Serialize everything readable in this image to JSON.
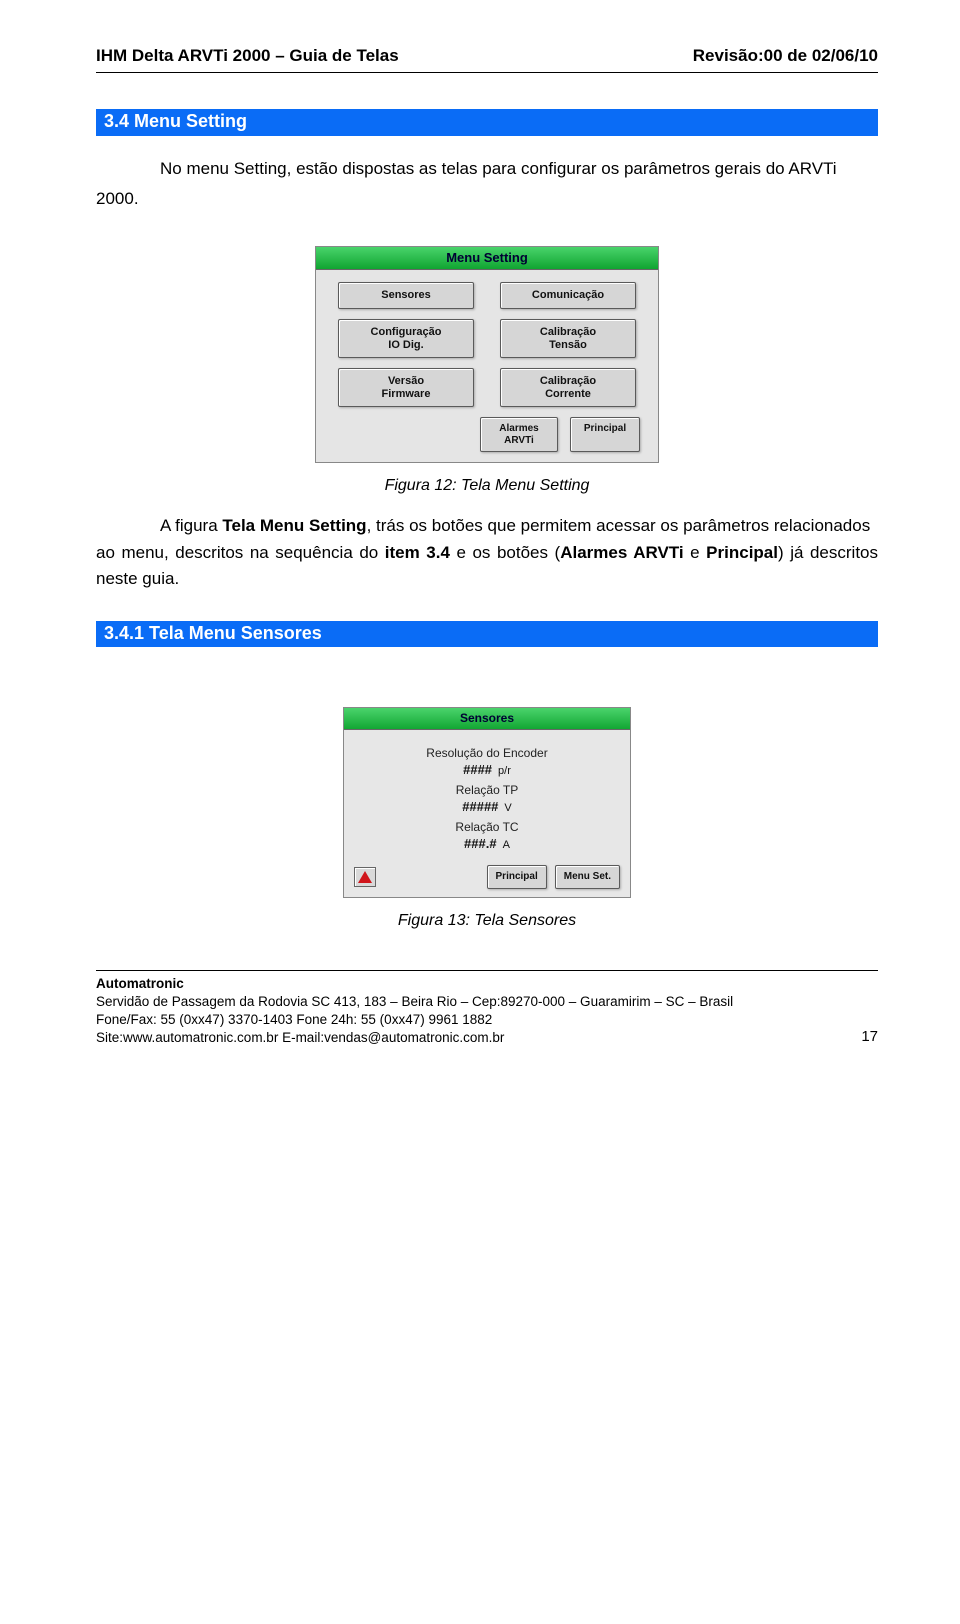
{
  "header": {
    "left": "IHM Delta ARVTi 2000 – Guia de Telas",
    "right": "Revisão:00 de 02/06/10"
  },
  "section1": {
    "title": "3.4  Menu Setting",
    "intro_right": "No menu Setting, estão dispostas as telas para configurar os parâmetros gerais do ARVTi",
    "intro_left": "2000."
  },
  "fig12": {
    "caption": "Figura 12: Tela Menu Setting",
    "hmi_title": "Menu Setting",
    "buttons": {
      "sensores": "Sensores",
      "comunicacao": "Comunicação",
      "config_io": "Configuração\nIO Dig.",
      "calib_tensao": "Calibração\nTensão",
      "versao_fw": "Versão\nFirmware",
      "calib_corr": "Calibração\nCorrente",
      "alarmes": "Alarmes\nARVTi",
      "principal": "Principal"
    }
  },
  "para2": "A figura Tela Menu Setting, trás os botões que permitem acessar os parâmetros relacionados ao menu, descritos na sequência do item 3.4 e os botões (Alarmes ARVTi e Principal) já descritos neste guia.",
  "para2_bold_lead": "Tela Menu Setting",
  "para2_bold_item": "item 3.4",
  "para2_bold_alarmes": "Alarmes ARVTi",
  "para2_bold_principal": "Principal",
  "section2": {
    "title": "3.4.1  Tela Menu Sensores"
  },
  "fig13": {
    "caption": "Figura 13: Tela Sensores",
    "hmi_title": "Sensores",
    "rows": {
      "r1_label": "Resolução do Encoder",
      "r1_val": "####",
      "r1_unit": "p/r",
      "r2_label": "Relação TP",
      "r2_val": "#####",
      "r2_unit": "V",
      "r3_label": "Relação TC",
      "r3_val": "###.#",
      "r3_unit": "A"
    },
    "btn_principal": "Principal",
    "btn_menuset": "Menu Set."
  },
  "footer": {
    "company": "Automatronic",
    "l1": "Servidão de Passagem da Rodovia SC 413, 183 – Beira Rio – Cep:89270-000 – Guaramirim – SC – Brasil",
    "l2": "Fone/Fax: 55 (0xx47) 3370-1403 Fone 24h: 55 (0xx47) 9961 1882",
    "l3": "Site:www.automatronic.com.br E-mail:vendas@automatronic.com.br",
    "page": "17"
  }
}
